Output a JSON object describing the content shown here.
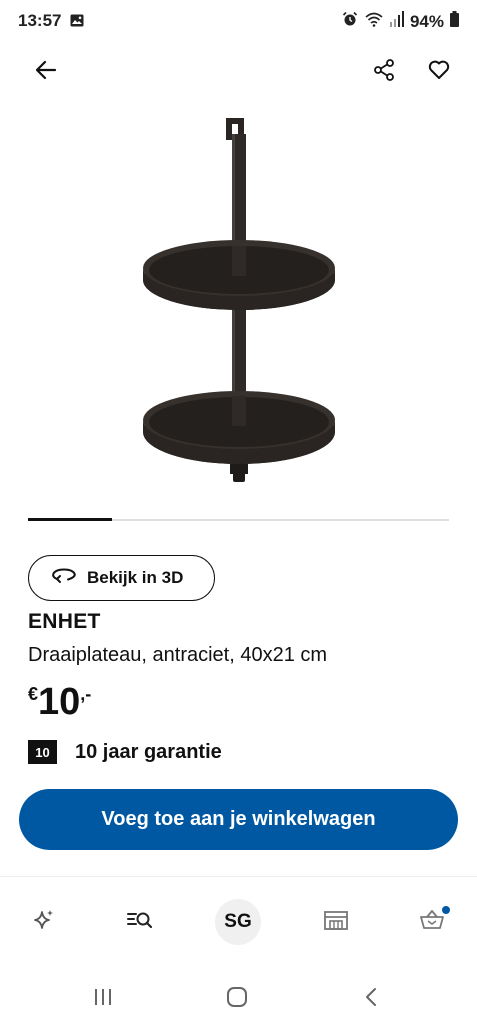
{
  "status_bar": {
    "time": "13:57",
    "battery": "94%",
    "icons": [
      "gallery-icon",
      "alarm-icon",
      "wifi-icon",
      "signal-icon",
      "battery-icon"
    ]
  },
  "top_bar": {
    "icons": [
      "back-arrow-icon",
      "share-icon",
      "heart-icon"
    ]
  },
  "carousel": {
    "progress": 0.2
  },
  "view3d": {
    "label": "Bekijk in 3D",
    "icon": "rotate-3d-icon"
  },
  "product": {
    "name": "ENHET",
    "description": "Draaiplateau, antraciet, 40x21 cm",
    "price": {
      "currency": "€",
      "integer": "10",
      "suffix": ",-"
    },
    "warranty": {
      "badge": "10",
      "text": "10 jaar garantie"
    }
  },
  "cta": {
    "label": "Voeg toe aan je winkelwagen"
  },
  "bottom_nav": {
    "items": [
      {
        "name": "sparkle",
        "icon": "sparkle-icon"
      },
      {
        "name": "search",
        "icon": "search-list-icon"
      },
      {
        "name": "profile",
        "label": "SG"
      },
      {
        "name": "store",
        "icon": "store-icon"
      },
      {
        "name": "cart",
        "icon": "basket-icon"
      }
    ]
  },
  "colors": {
    "brand_blue": "#0058a3",
    "text": "#111111",
    "badge_bg": "#111111"
  }
}
